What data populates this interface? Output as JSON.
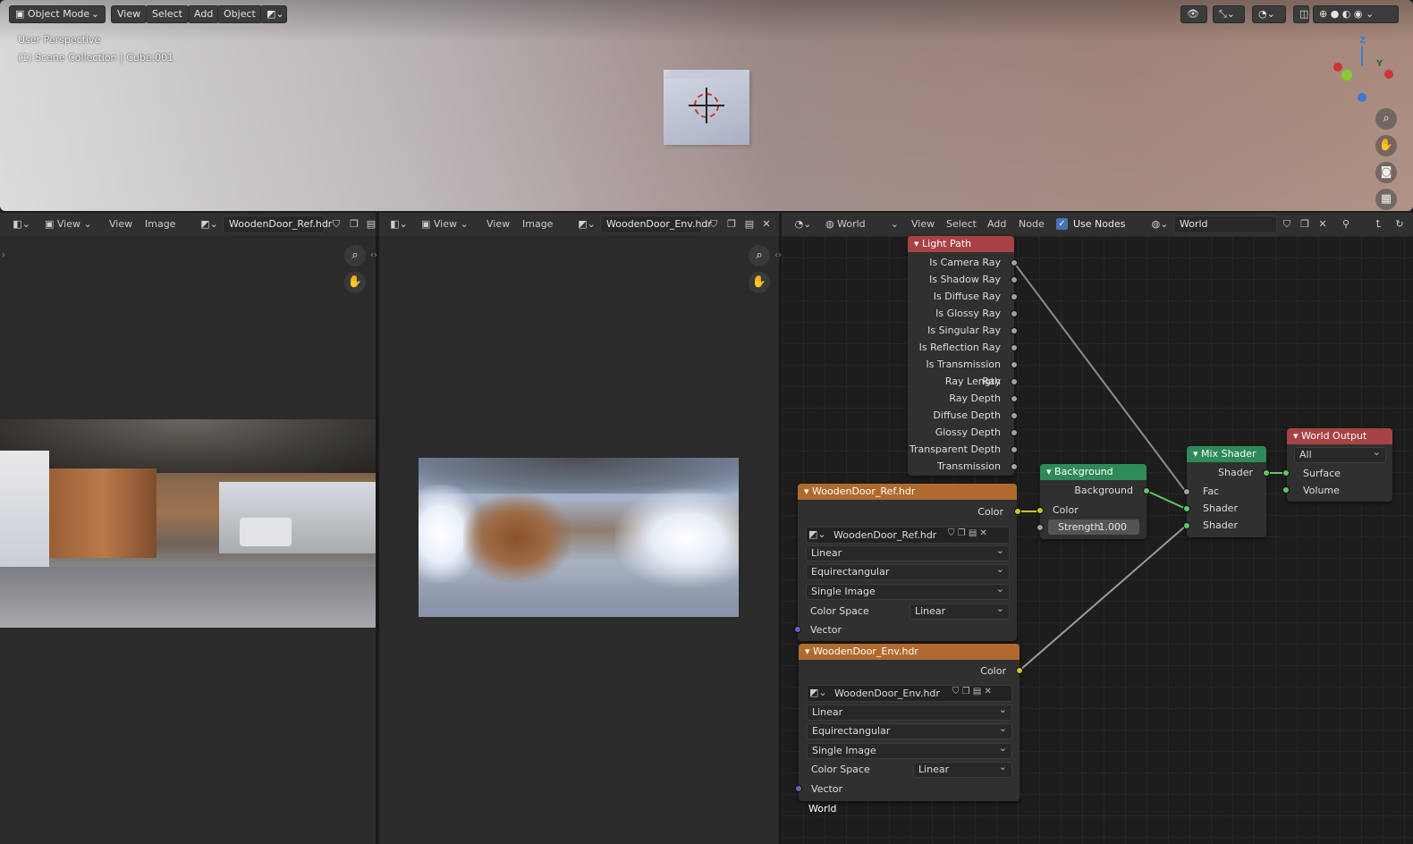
{
  "viewport": {
    "mode_label": "Object Mode",
    "menu": [
      "View",
      "Select",
      "Add",
      "Object"
    ],
    "perspective_label": "User Perspective",
    "collection_label": "(1) Scene Collection | Cube.001",
    "gizmo_axes": {
      "z": "Z",
      "y": "Y"
    }
  },
  "image_editor_left": {
    "view_label": "View",
    "menu": [
      "View",
      "Image"
    ],
    "image_name": "WoodenDoor_Ref.hdr"
  },
  "image_editor_right": {
    "view_label": "View",
    "menu": [
      "View",
      "Image"
    ],
    "image_name": "WoodenDoor_Env.hdr"
  },
  "node_editor": {
    "world_type_label": "World",
    "menu": [
      "View",
      "Select",
      "Add",
      "Node"
    ],
    "use_nodes_label": "Use Nodes",
    "use_nodes_checked": true,
    "world_name": "World",
    "footer_label": "World"
  },
  "nodes": {
    "light_path": {
      "title": "Light Path",
      "outputs": [
        "Is Camera Ray",
        "Is Shadow Ray",
        "Is Diffuse Ray",
        "Is Glossy Ray",
        "Is Singular Ray",
        "Is Reflection Ray",
        "Is Transmission Ray",
        "Ray Length",
        "Ray Depth",
        "Diffuse Depth",
        "Glossy Depth",
        "Transparent Depth",
        "Transmission Depth"
      ]
    },
    "env_ref": {
      "title": "WoodenDoor_Ref.hdr",
      "output": "Color",
      "image": "WoodenDoor_Ref.hdr",
      "interpolation": "Linear",
      "projection": "Equirectangular",
      "source": "Single Image",
      "color_space_label": "Color Space",
      "color_space": "Linear",
      "input": "Vector"
    },
    "env_env": {
      "title": "WoodenDoor_Env.hdr",
      "output": "Color",
      "image": "WoodenDoor_Env.hdr",
      "interpolation": "Linear",
      "projection": "Equirectangular",
      "source": "Single Image",
      "color_space_label": "Color Space",
      "color_space": "Linear",
      "input": "Vector"
    },
    "background": {
      "title": "Background",
      "output": "Background",
      "color_label": "Color",
      "strength_label": "Strength",
      "strength_value": "1.000"
    },
    "mix_shader": {
      "title": "Mix Shader",
      "output": "Shader",
      "inputs": [
        "Fac",
        "Shader",
        "Shader"
      ]
    },
    "world_output": {
      "title": "World Output",
      "target": "All",
      "inputs": [
        "Surface",
        "Volume"
      ]
    }
  },
  "colors": {
    "header_input": "#a84245",
    "header_texture": "#b06a2e",
    "header_shader": "#2f8a5a",
    "header_output": "#a84245"
  }
}
